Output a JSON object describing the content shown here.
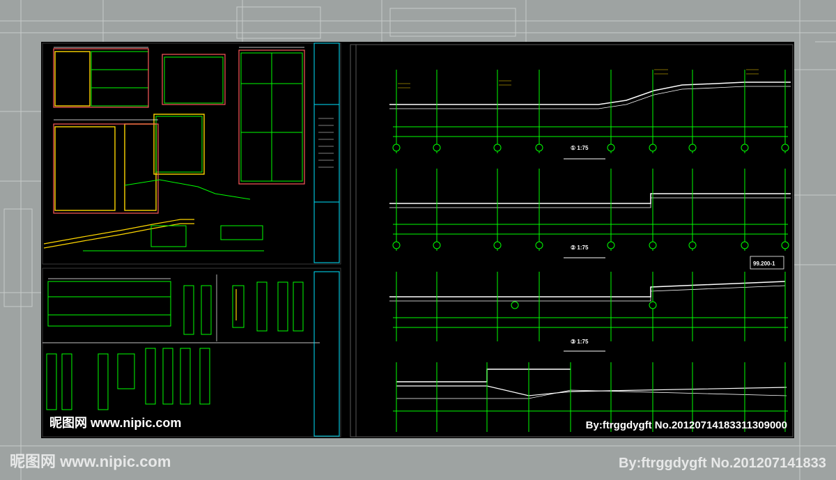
{
  "watermark": {
    "site": "昵图网 www.nipic.com",
    "credit": "By:ftrggdygft  No.20120714183311309000",
    "credit_cropped": "By:ftrggdygft  No.201207141833"
  },
  "drawing": {
    "section_labels": [
      "① 1:75",
      "② 1:75",
      "③ 1:75"
    ],
    "elevation_tag": "99.200-1"
  },
  "colors": {
    "cad_background": "#000000",
    "cad_green": "#00ff00",
    "cad_white": "#ffffff",
    "cad_yellow": "#ffd700",
    "cad_cyan": "#00e5ff",
    "page_background": "#9ea3a2"
  }
}
